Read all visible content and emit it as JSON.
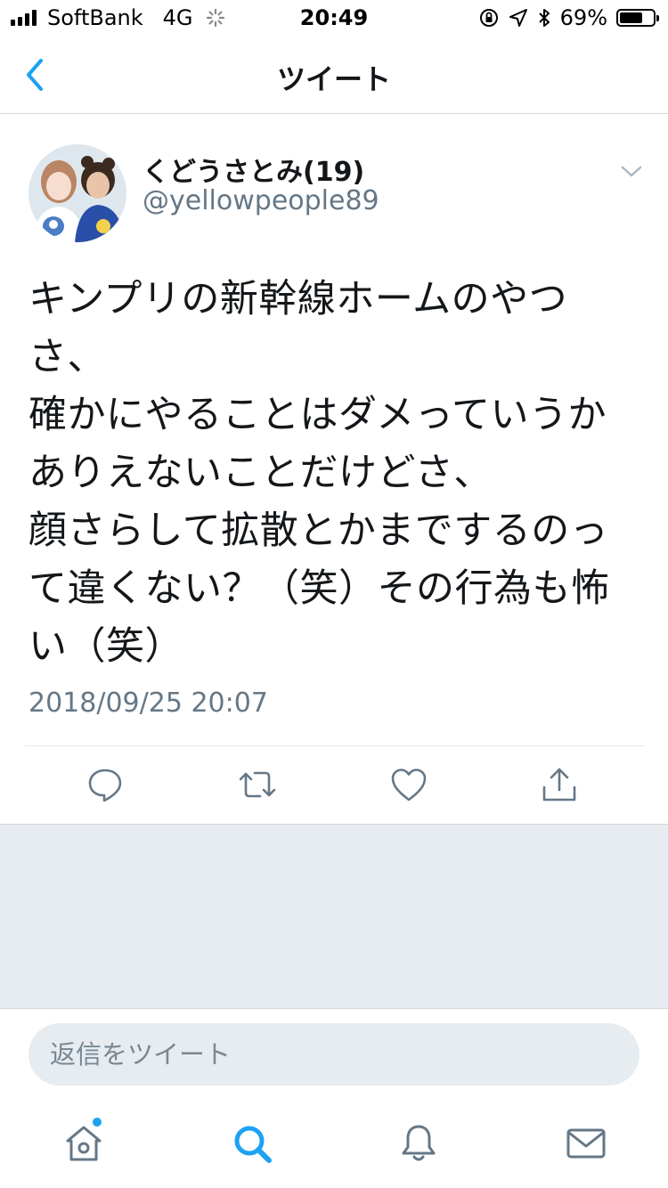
{
  "status_bar": {
    "carrier": "SoftBank",
    "network": "4G",
    "time": "20:49",
    "battery_percent": "69%",
    "battery_level": 0.69,
    "signal_bars": 4
  },
  "nav": {
    "title": "ツイート",
    "back_icon": "chevron-left-icon"
  },
  "tweet": {
    "user_name": "くどうさとみ(19)",
    "user_handle": "@yellowpeople89",
    "text": "キンプリの新幹線ホームのやつさ、\n確かにやることはダメっていうかありえないことだけどさ、\n顔さらして拡散とかまでするのって違くない？（笑）その行為も怖い（笑）",
    "timestamp": "2018/09/25 20:07",
    "actions": [
      "reply-icon",
      "retweet-icon",
      "like-icon",
      "share-icon"
    ]
  },
  "reply": {
    "placeholder": "返信をツイート"
  },
  "tabbar": {
    "items": [
      "home-icon",
      "search-icon",
      "notifications-icon",
      "messages-icon"
    ],
    "active": "search-icon",
    "home_has_badge": true
  },
  "colors": {
    "accent": "#1da1f2",
    "text_primary": "#14171a",
    "text_secondary": "#657786",
    "icon_gray": "#657786",
    "background_gray": "#e6ecf0"
  }
}
